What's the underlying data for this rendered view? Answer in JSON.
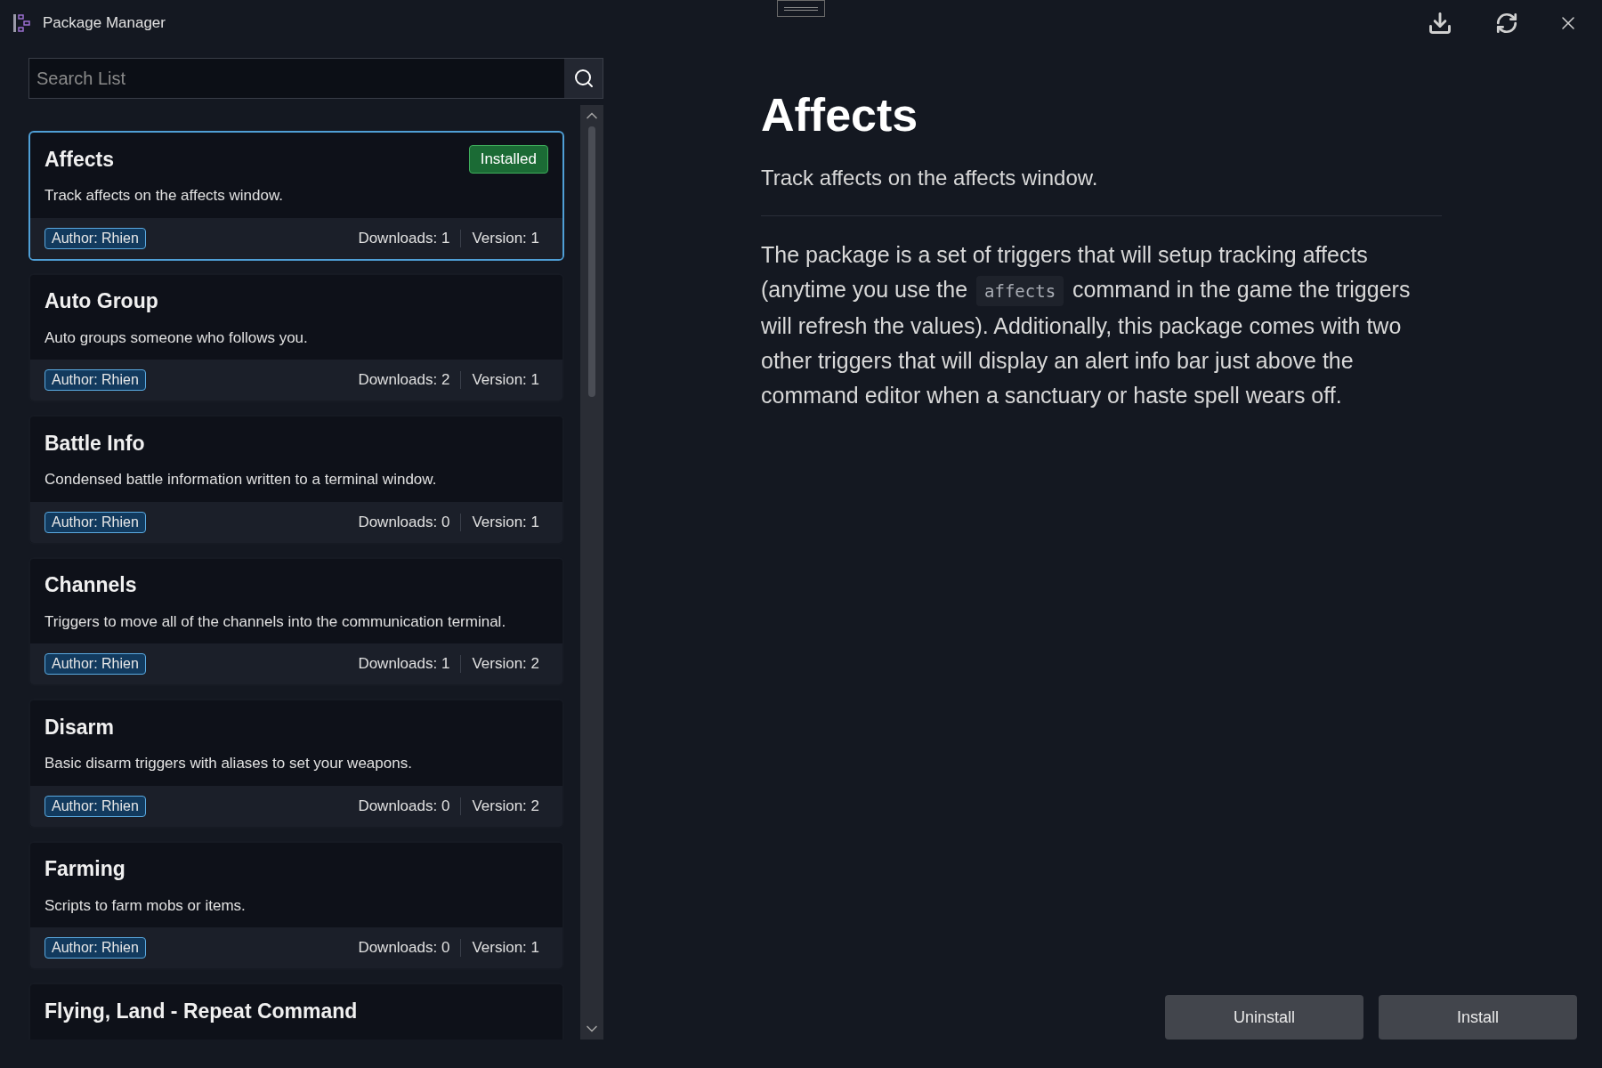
{
  "window": {
    "title": "Package Manager"
  },
  "search": {
    "placeholder": "Search List"
  },
  "packages": [
    {
      "name": "Affects",
      "description": "Track affects on the affects window.",
      "author": "Author: Rhien",
      "downloads": "Downloads: 1",
      "version": "Version: 1",
      "badge": "Installed",
      "selected": true
    },
    {
      "name": "Auto Group",
      "description": "Auto groups someone who follows you.",
      "author": "Author: Rhien",
      "downloads": "Downloads: 2",
      "version": "Version: 1",
      "selected": false
    },
    {
      "name": "Battle Info",
      "description": "Condensed battle information written to a terminal window.",
      "author": "Author: Rhien",
      "downloads": "Downloads: 0",
      "version": "Version: 1",
      "selected": false
    },
    {
      "name": "Channels",
      "description": "Triggers to move all of the channels into the communication terminal.",
      "author": "Author: Rhien",
      "downloads": "Downloads: 1",
      "version": "Version: 2",
      "selected": false
    },
    {
      "name": "Disarm",
      "description": "Basic disarm triggers with aliases to set your weapons.",
      "author": "Author: Rhien",
      "downloads": "Downloads: 0",
      "version": "Version: 2",
      "selected": false
    },
    {
      "name": "Farming",
      "description": "Scripts to farm mobs or items.",
      "author": "Author: Rhien",
      "downloads": "Downloads: 0",
      "version": "Version: 1",
      "selected": false
    },
    {
      "name": "Flying, Land - Repeat Command",
      "selected": false
    }
  ],
  "detail": {
    "title": "Affects",
    "summary": "Track affects on the affects window.",
    "body": [
      {
        "kind": "text",
        "text": "The package is a set of triggers that will setup tracking affects (anytime you use the "
      },
      {
        "kind": "code",
        "text": "affects"
      },
      {
        "kind": "text",
        "text": " command in the game the triggers will refresh the values). Additionally, this package comes with two other triggers that will display an alert info bar just above the command editor when a sanctuary or haste spell wears off."
      }
    ]
  },
  "buttons": [
    "Uninstall",
    "Install"
  ]
}
